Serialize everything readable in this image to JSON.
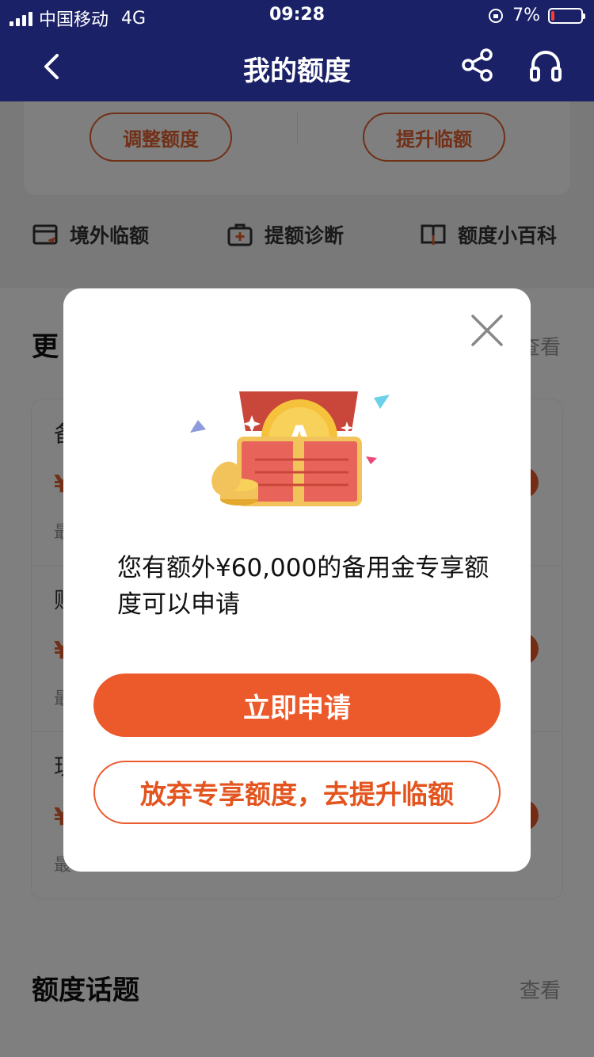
{
  "status_bar": {
    "carrier": "中国移动",
    "network": "4G",
    "time": "09:28",
    "battery": "7%"
  },
  "nav": {
    "title": "我的额度",
    "back_icon": "chevron-left-icon",
    "share_icon": "share-icon",
    "service_icon": "headset-icon"
  },
  "top_card": {
    "adjust_label": "调整额度",
    "raise_label": "提升临额"
  },
  "quick_links": [
    {
      "label": "境外临额",
      "icon": "overseas-card-icon"
    },
    {
      "label": "提额诊断",
      "icon": "medical-kit-icon"
    },
    {
      "label": "额度小百科",
      "icon": "book-icon"
    }
  ],
  "sections": {
    "more_products": {
      "title": "更",
      "more": "查看"
    },
    "products": [
      {
        "title": "备",
        "amount": "¥",
        "sub": "最"
      },
      {
        "title": "账",
        "amount": "¥",
        "sub": "最"
      },
      {
        "title": "现",
        "amount": "¥",
        "sub": "最"
      }
    ],
    "topics": {
      "title": "额度话题",
      "more": "查看"
    }
  },
  "modal": {
    "message": "您有额外¥60,000的备用金专享额度可以申请",
    "primary_label": "立即申请",
    "secondary_label": "放弃专享额度，去提升临额",
    "close_icon": "close-icon",
    "illustration": "treasure-chest-icon"
  },
  "colors": {
    "nav_bg": "#1a2167",
    "accent": "#ec5a2c",
    "overlay": "rgba(0,0,0,0.5)"
  }
}
